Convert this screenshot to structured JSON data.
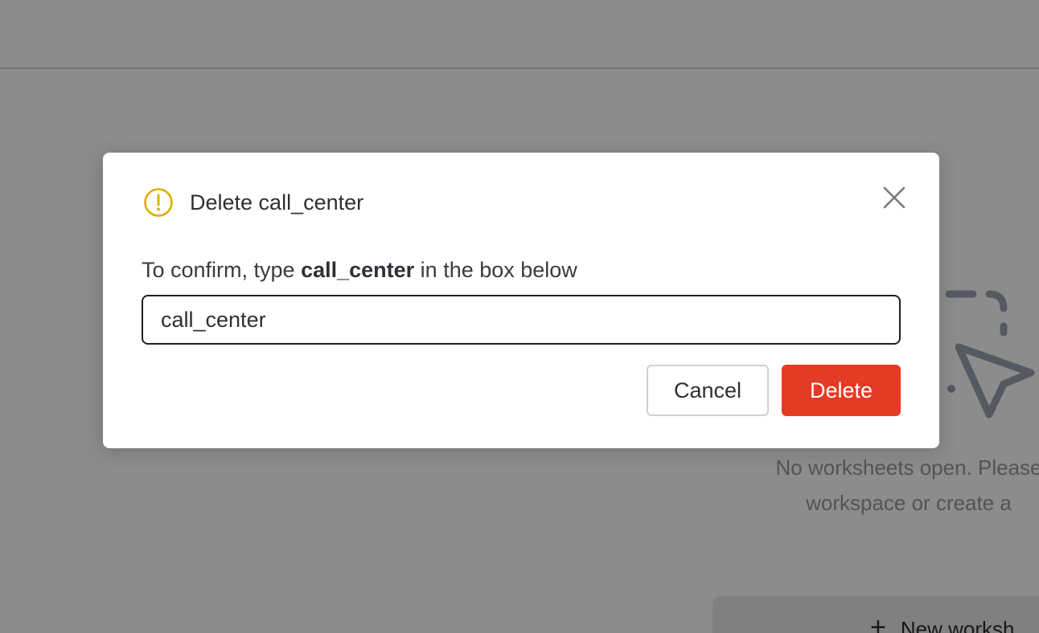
{
  "background": {
    "empty_state_line1": "No worksheets open. Please",
    "empty_state_line2": "workspace or create a",
    "new_worksheet_label": "New worksh",
    "new_worksheet_icon": "plus-icon",
    "illustration_icon": "cursor-pointer-icon"
  },
  "dialog": {
    "title": "Delete call_center",
    "title_icon": "warning-circle-icon",
    "close_icon": "close-icon",
    "confirm_prefix": "To confirm, type ",
    "confirm_name": "call_center",
    "confirm_suffix": " in the box below",
    "input_value": "call_center",
    "cancel_label": "Cancel",
    "delete_label": "Delete"
  },
  "colors": {
    "warning": "#e0ab00",
    "danger": "#e43b25",
    "overlay": "rgba(0,0,0,0.45)"
  }
}
